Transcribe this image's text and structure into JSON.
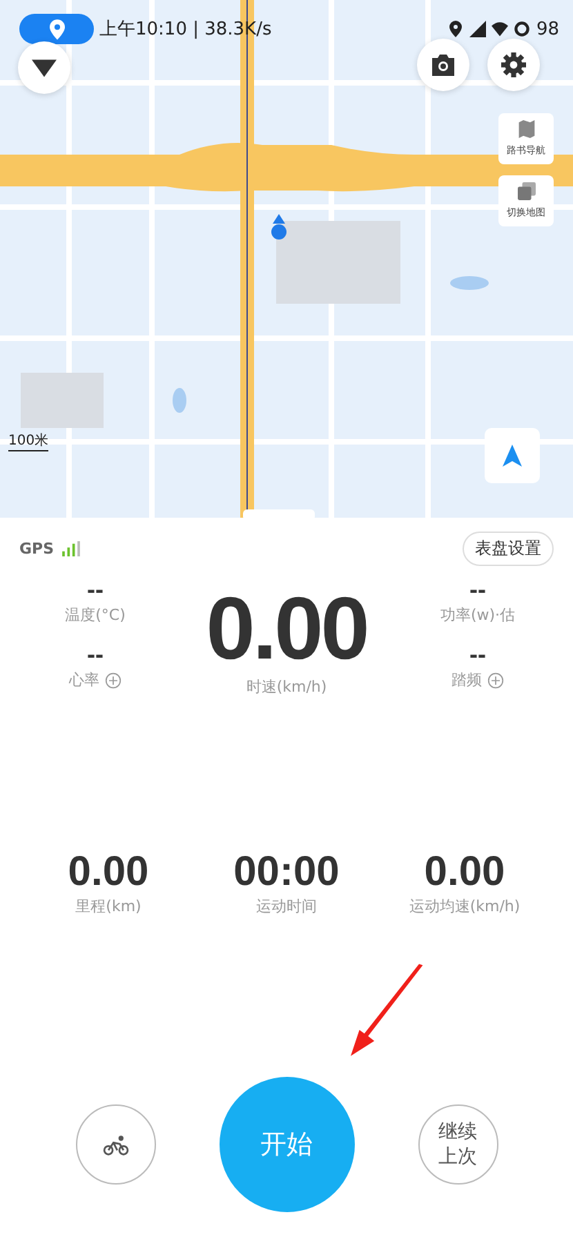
{
  "status_bar": {
    "time_speed": "上午10:10 | 38.3K/s",
    "battery": "98"
  },
  "map": {
    "scale": "100米",
    "side_buttons": [
      {
        "kind": "route",
        "label": "路书导航"
      },
      {
        "kind": "layers",
        "label": "切换地图"
      }
    ]
  },
  "panel": {
    "gps_label": "GPS",
    "dial_settings": "表盘设置",
    "left_metrics": [
      {
        "value": "--",
        "label": "温度(°C)",
        "addable": false
      },
      {
        "value": "--",
        "label": "心率",
        "addable": true
      }
    ],
    "main_metric": {
      "value": "0.00",
      "label": "时速(km/h)"
    },
    "right_metrics": [
      {
        "value": "--",
        "label": "功率(w)·估",
        "addable": false
      },
      {
        "value": "--",
        "label": "踏频",
        "addable": true
      }
    ],
    "summary": [
      {
        "value": "0.00",
        "label": "里程(km)"
      },
      {
        "value": "00:00",
        "label": "运动时间"
      },
      {
        "value": "0.00",
        "label": "运动均速(km/h)"
      }
    ],
    "start_button": "开始",
    "resume_button": "继续上次"
  }
}
